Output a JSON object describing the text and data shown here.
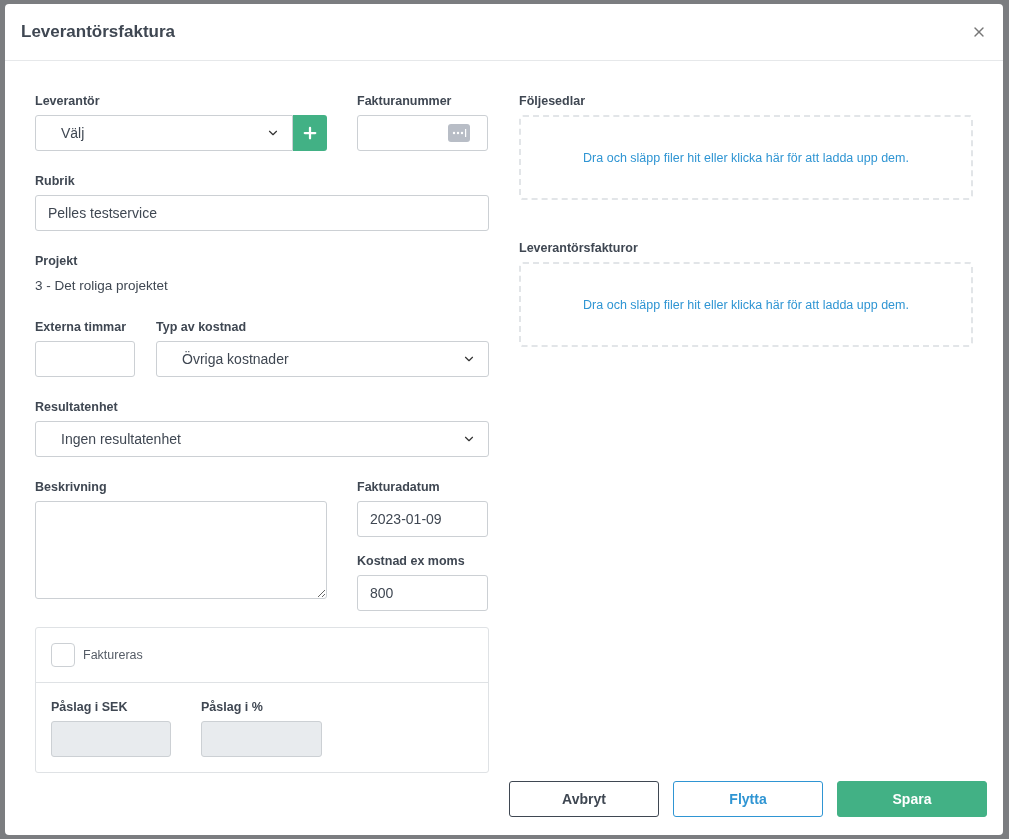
{
  "dialog": {
    "title": "Leverantörsfaktura"
  },
  "supplier": {
    "label": "Leverantör",
    "value": "Välj"
  },
  "invoice_number": {
    "label": "Fakturanummer"
  },
  "heading": {
    "label": "Rubrik",
    "value": "Pelles testservice"
  },
  "project": {
    "label": "Projekt",
    "value": "3 - Det roliga projektet"
  },
  "external_hours": {
    "label": "Externa timmar"
  },
  "cost_type": {
    "label": "Typ av kostnad",
    "value": "Övriga kostnader"
  },
  "result_unit": {
    "label": "Resultatenhet",
    "value": "Ingen resultatenhet"
  },
  "description": {
    "label": "Beskrivning"
  },
  "invoice_date": {
    "label": "Fakturadatum",
    "value": "2023-01-09"
  },
  "cost_ex_vat": {
    "label": "Kostnad ex moms",
    "value": "800"
  },
  "billing": {
    "label": "Faktureras",
    "checked": false,
    "fields": [
      {
        "label": "Påslag i SEK",
        "disabled": true
      },
      {
        "label": "Påslag i %",
        "disabled": true
      }
    ]
  },
  "dropzones": [
    {
      "label": "Följesedlar",
      "text": "Dra och släpp filer hit eller klicka här för att ladda upp dem."
    },
    {
      "label": "Leverantörsfakturor",
      "text": "Dra och släpp filer hit eller klicka här för att ladda upp dem."
    }
  ],
  "buttons": [
    {
      "label": "Avbryt",
      "kind": "neutral"
    },
    {
      "label": "Flytta",
      "kind": "outline"
    },
    {
      "label": "Spara",
      "kind": "primary"
    }
  ]
}
